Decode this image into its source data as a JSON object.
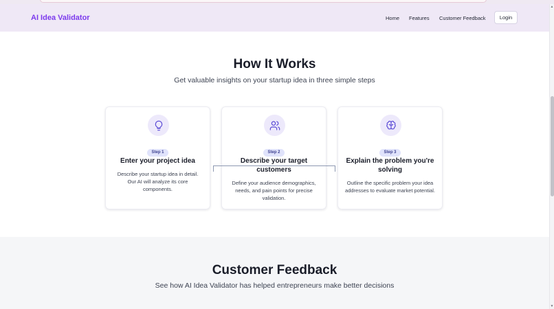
{
  "nav": {
    "brand": "AI Idea Validator",
    "links": [
      "Home",
      "Features",
      "Customer Feedback"
    ],
    "login": "Login"
  },
  "how_it_works": {
    "title": "How It Works",
    "subtitle": "Get valuable insights on your startup idea in three simple steps",
    "steps": [
      {
        "icon": "lightbulb-icon",
        "badge": "Step 1",
        "title": "Enter your project idea",
        "description": "Describe your startup idea in detail. Our AI will analyze its core components."
      },
      {
        "icon": "users-icon",
        "badge": "Step 2",
        "title": "Describe your target customers",
        "description": "Define your audience demographics, needs, and pain points for precise validation."
      },
      {
        "icon": "brain-icon",
        "badge": "Step 3",
        "title": "Explain the problem you're solving",
        "description": "Outline the specific problem your idea addresses to evaluate market potential."
      }
    ]
  },
  "feedback": {
    "title": "Customer Feedback",
    "subtitle": "See how AI Idea Validator has helped entrepreneurs make better decisions"
  },
  "colors": {
    "brand": "#7c3aed",
    "nav_background": "#efe8f6",
    "icon_circle": "#ede9fb",
    "badge_background": "#e0e3fb",
    "section_background": "#f5f6f8"
  }
}
